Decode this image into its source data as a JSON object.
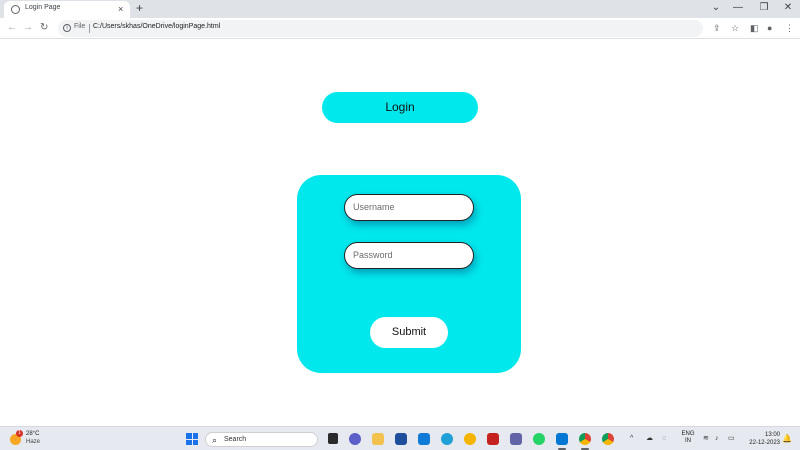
{
  "browser": {
    "tab_title": "Login Page",
    "tab_close": "×",
    "new_tab": "+",
    "window_controls": {
      "dropdown": "⌄",
      "minimize": "—",
      "maximize": "❐",
      "close": "✕"
    },
    "nav": {
      "back": "←",
      "forward": "→",
      "reload": "↻"
    },
    "address_prefix": "File",
    "url": "C:/Users/skhas/OneDrive/loginPage.html"
  },
  "page": {
    "header": "Login",
    "form": {
      "username_placeholder": "Username",
      "password_placeholder": "Password",
      "submit_label": "Submit"
    },
    "accent_color": "#00e8ec"
  },
  "taskbar": {
    "weather_temp": "28°C",
    "weather_desc": "Haze",
    "weather_badge": "1",
    "search_label": "Search",
    "lang_line1": "ENG",
    "lang_line2": "IN",
    "time": "13:00",
    "date": "22-12-2023"
  }
}
